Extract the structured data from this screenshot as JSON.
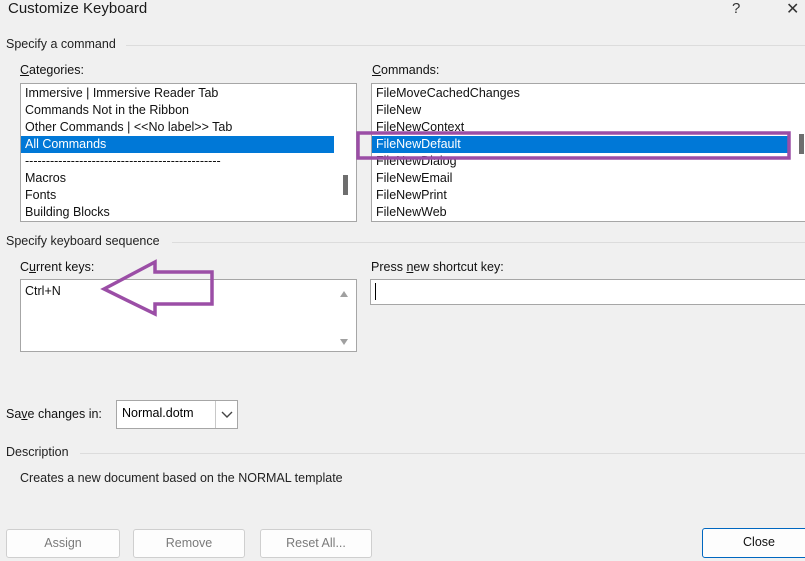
{
  "window": {
    "title": "Customize Keyboard",
    "help_label": "?",
    "close_label": "✕"
  },
  "specify_command": {
    "group_label": "Specify a command",
    "categories": {
      "label_accel": "C",
      "label_rest": "ategories:",
      "items": [
        "Immersive | Immersive Reader Tab",
        "Commands Not in the Ribbon",
        "Other Commands | <<No label>> Tab",
        "All Commands",
        "-----------------------------------------------",
        "Macros",
        "Fonts",
        "Building Blocks"
      ],
      "selected_index": 3
    },
    "commands": {
      "label_accel": "C",
      "label_rest": "ommands:",
      "items": [
        "FileMoveCachedChanges",
        "FileNew",
        "FileNewContext",
        "FileNewDefault",
        "FileNewDialog",
        "FileNewEmail",
        "FileNewPrint",
        "FileNewWeb"
      ],
      "selected_index": 3
    }
  },
  "keyboard_sequence": {
    "group_label": "Specify keyboard sequence",
    "current_keys": {
      "label_accel": "u",
      "label_pre": "C",
      "label_rest": "rrent keys:",
      "items": [
        "Ctrl+N"
      ]
    },
    "press_new": {
      "label_pre": "Press ",
      "label_accel": "n",
      "label_rest": "ew shortcut key:",
      "value": ""
    }
  },
  "save_changes": {
    "label_pre": "Sa",
    "label_accel": "v",
    "label_rest": "e changes in:",
    "value": "Normal.dotm"
  },
  "description": {
    "group_label": "Description",
    "text": "Creates a new document based on the NORMAL template"
  },
  "buttons": {
    "assign": "Assign",
    "remove": "Remove",
    "reset_all": "Reset All...",
    "close": "Close"
  },
  "annotations": {
    "highlight_color": "#9b4ea6",
    "arrow_color": "#9b4ea6"
  },
  "icons": {
    "scroll_up": "scroll-up-arrow-icon",
    "scroll_down": "scroll-down-arrow-icon",
    "dropdown": "chevron-down-icon"
  }
}
